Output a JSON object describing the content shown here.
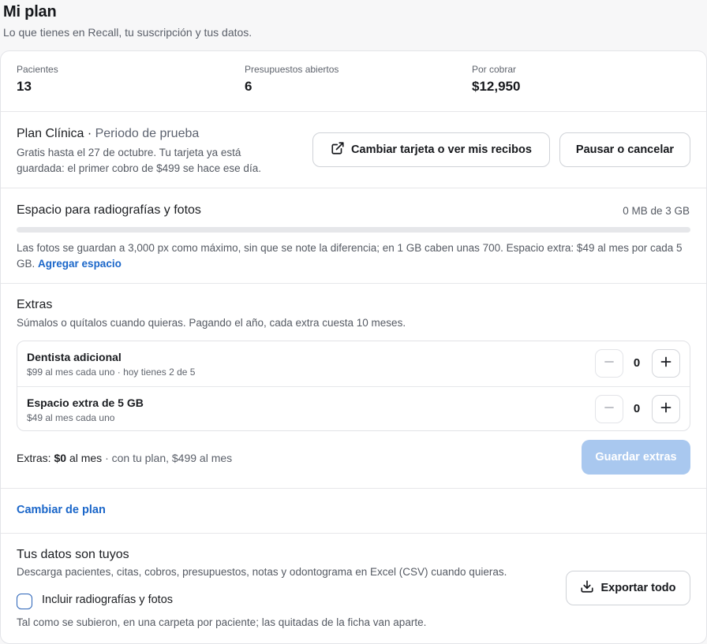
{
  "header": {
    "title": "Mi plan",
    "subtitle": "Lo que tienes en Recall, tu suscripción y tus datos."
  },
  "stats": [
    {
      "label": "Pacientes",
      "value": "13"
    },
    {
      "label": "Presupuestos abiertos",
      "value": "6"
    },
    {
      "label": "Por cobrar",
      "value": "$12,950"
    }
  ],
  "plan": {
    "name": "Plan Clínica",
    "separator": "·",
    "status": "Periodo de prueba",
    "description": "Gratis hasta el 27 de octubre. Tu tarjeta ya está guardada: el primer cobro de $499 se hace ese día.",
    "card_button": "Cambiar tarjeta o ver mis recibos",
    "pause_button": "Pausar o cancelar"
  },
  "storage": {
    "title": "Espacio para radiografías y fotos",
    "usage": "0 MB de 3 GB",
    "used_fraction": 0,
    "description": "Las fotos se guardan a 3,000 px como máximo, sin que se note la diferencia; en 1 GB caben unas 700. Espacio extra: $49 al mes por cada 5 GB.",
    "add_link": "Agregar espacio"
  },
  "extras": {
    "title": "Extras",
    "description": "Súmalos o quítalos cuando quieras. Pagando el año, cada extra cuesta 10 meses.",
    "items": [
      {
        "name": "Dentista adicional",
        "detail": "$99 al mes cada uno · hoy tienes 2 de 5",
        "quantity": "0"
      },
      {
        "name": "Espacio extra de 5 GB",
        "detail": "$49 al mes cada uno",
        "quantity": "0"
      }
    ],
    "total_label": "Extras:",
    "total_amount": "$0",
    "total_period": "al mes",
    "total_note": "· con tu plan, $499 al mes",
    "save_button": "Guardar extras"
  },
  "change_plan": {
    "label": "Cambiar de plan"
  },
  "data_export": {
    "title": "Tus datos son tuyos",
    "description": "Descarga pacientes, citas, cobros, presupuestos, notas y odontograma en Excel (CSV) cuando quieras.",
    "checkbox_label": "Incluir radiografías y fotos",
    "checkbox_checked": false,
    "note": "Tal como se subieron, en una carpeta por paciente; las quitadas de la ficha van aparte.",
    "export_button": "Exportar todo"
  },
  "colors": {
    "accent": "#1a66c9",
    "disabled_button": "#a9c8ef",
    "checkbox_border": "#2a63b8"
  },
  "icons": {
    "card_button": "external-link-icon",
    "export_button": "download-icon",
    "stepper_minus": "minus-icon",
    "stepper_plus": "plus-icon"
  }
}
